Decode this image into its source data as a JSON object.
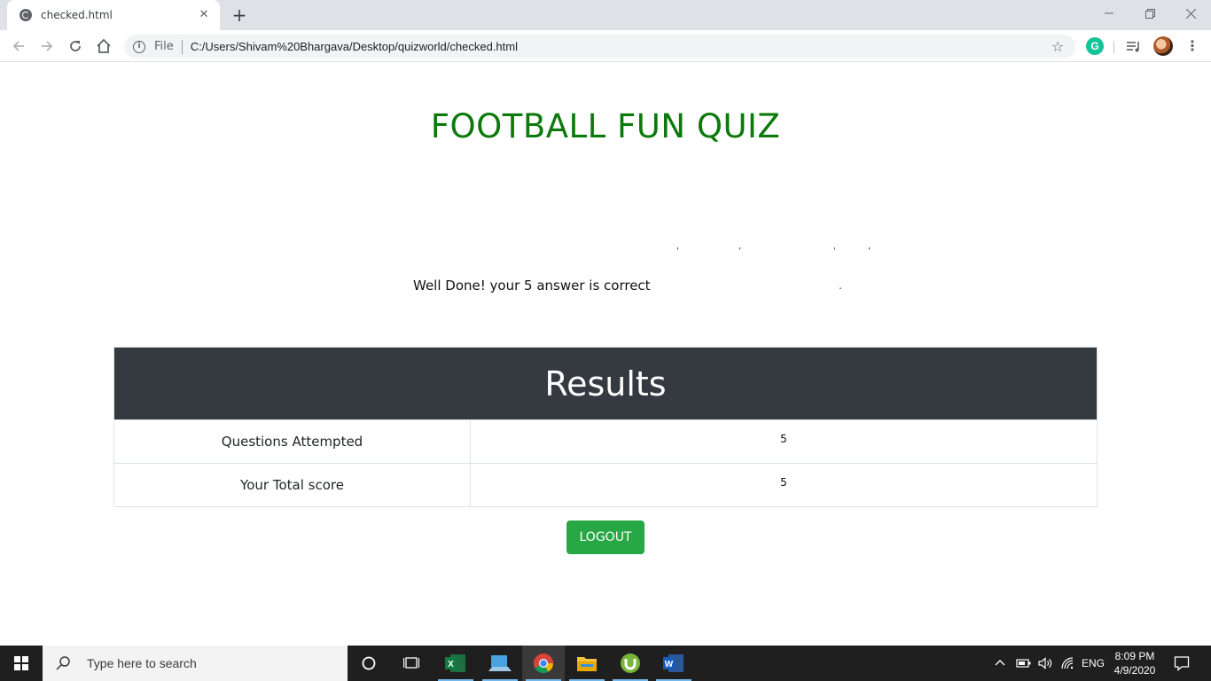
{
  "browser": {
    "tab_title": "checked.html",
    "new_tab_label": "+",
    "omnibox": {
      "security_label": "File",
      "url": "C:/Users/Shivam%20Bhargava/Desktop/quizworld/checked.html"
    },
    "extensions": {
      "grammarly_letter": "G"
    }
  },
  "page": {
    "title": "FOOTBALL FUN QUIZ",
    "message": "Well Done! your 5 answer is correct",
    "results": {
      "heading": "Results",
      "rows": [
        {
          "label": "Questions Attempted",
          "value": "5"
        },
        {
          "label": "Your Total score",
          "value": "5"
        }
      ]
    },
    "logout_label": "LOGOUT"
  },
  "taskbar": {
    "search_placeholder": "Type here to search",
    "language": "ENG",
    "time": "8:09 PM",
    "date": "4/9/2020"
  },
  "colors": {
    "title_green": "#0b7a0b",
    "results_header": "#343a40",
    "logout_green": "#28a745"
  }
}
